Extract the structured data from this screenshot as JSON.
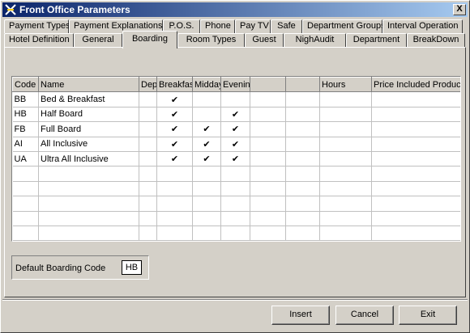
{
  "window": {
    "title": "Front Office Parameters",
    "close_label": "X"
  },
  "tabs_row1": [
    "Payment Types",
    "Payment Explanations",
    "P.O.S.",
    "Phone",
    "Pay TV",
    "Safe",
    "Department Groups",
    "Interval Operation"
  ],
  "tabs_row2": [
    "Hotel Definition",
    "General",
    "Boarding",
    "Room Types",
    "Guest",
    "NighAudit",
    "Department",
    "BreakDown"
  ],
  "active_tab": "Boarding",
  "grid": {
    "columns": [
      "Code",
      "Name",
      "Dep",
      "Breakfas",
      "Midday",
      "Evenin",
      "",
      "",
      "Hours",
      "Price Included Products"
    ],
    "check_glyph": "✔",
    "rows": [
      {
        "code": "BB",
        "name": "Bed & Breakfast",
        "breakfast": true,
        "midday": false,
        "evening": false
      },
      {
        "code": "HB",
        "name": "Half Board",
        "breakfast": true,
        "midday": false,
        "evening": true
      },
      {
        "code": "FB",
        "name": "Full Board",
        "breakfast": true,
        "midday": true,
        "evening": true
      },
      {
        "code": "AI",
        "name": "All Inclusive",
        "breakfast": true,
        "midday": true,
        "evening": true
      },
      {
        "code": "UA",
        "name": "Ultra All Inclusive",
        "breakfast": true,
        "midday": true,
        "evening": true
      }
    ],
    "empty_rows": 5
  },
  "default_boarding": {
    "label": "Default Boarding Code",
    "value": "HB"
  },
  "buttons": {
    "insert": "Insert",
    "cancel": "Cancel",
    "exit": "Exit"
  }
}
